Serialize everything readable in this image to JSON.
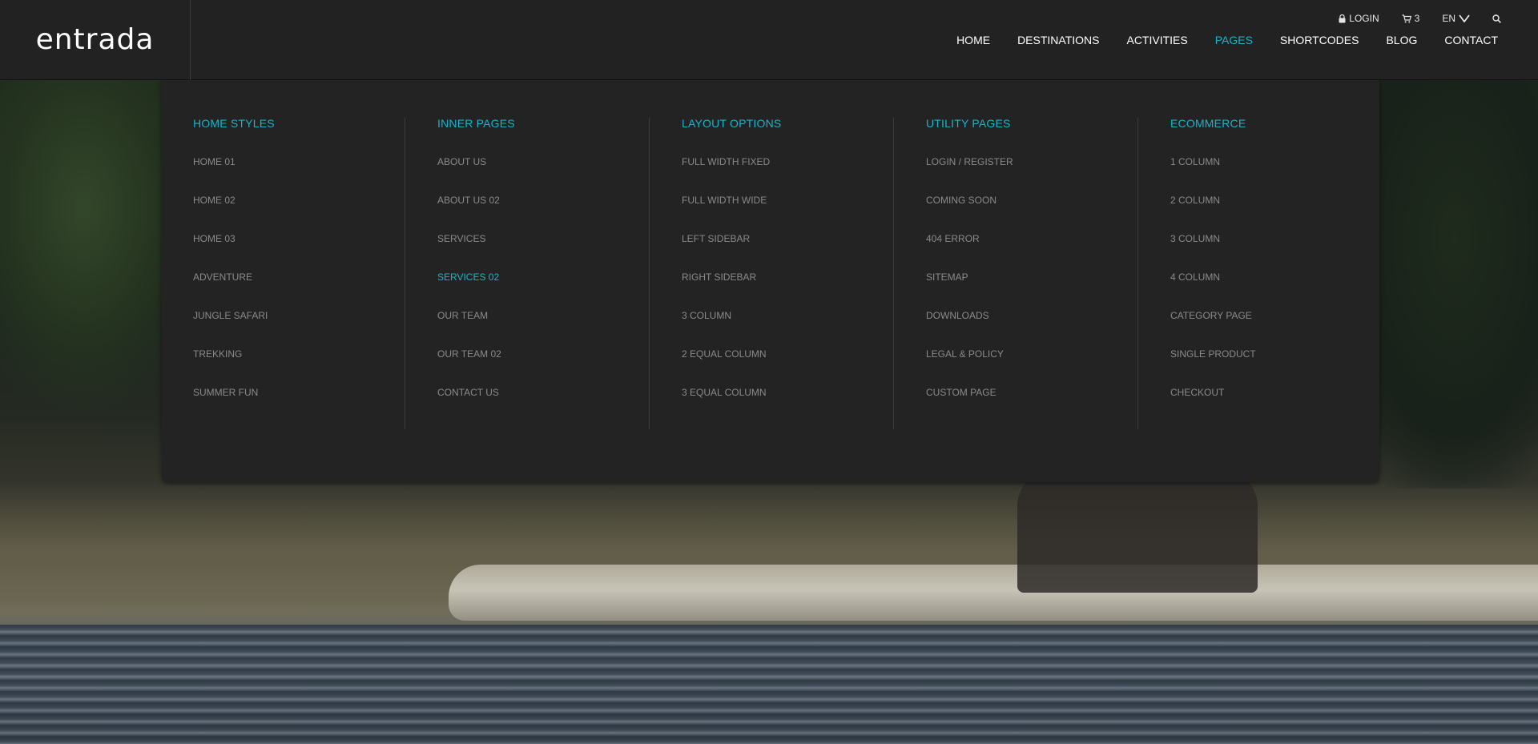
{
  "brand": {
    "logo_text": "entrada"
  },
  "utility": {
    "login_label": "LOGIN",
    "cart_count": "3",
    "language": "EN",
    "icons": {
      "login": "lock-icon",
      "cart": "cart-icon",
      "language": "chevron-down-icon",
      "search": "search-icon"
    }
  },
  "nav": {
    "items": [
      {
        "label": "HOME",
        "active": false
      },
      {
        "label": "DESTINATIONS",
        "active": false
      },
      {
        "label": "ACTIVITIES",
        "active": false
      },
      {
        "label": "PAGES",
        "active": true
      },
      {
        "label": "SHORTCODES",
        "active": false
      },
      {
        "label": "BLOG",
        "active": false
      },
      {
        "label": "CONTACT",
        "active": false
      }
    ]
  },
  "mega_menu": {
    "columns": [
      {
        "title": "HOME STYLES",
        "items": [
          "HOME 01",
          "HOME 02",
          "HOME 03",
          "ADVENTURE",
          "JUNGLE SAFARI",
          "TREKKING",
          "SUMMER FUN"
        ]
      },
      {
        "title": "INNER PAGES",
        "items": [
          "ABOUT US",
          "ABOUT US 02",
          "SERVICES",
          "SERVICES 02",
          "OUR TEAM",
          "OUR TEAM 02",
          "CONTACT US"
        ],
        "active_item": "SERVICES 02"
      },
      {
        "title": "LAYOUT OPTIONS",
        "items": [
          "FULL WIDTH FIXED",
          "FULL WIDTH WIDE",
          "LEFT SIDEBAR",
          "RIGHT SIDEBAR",
          "3 COLUMN",
          "2 EQUAL COLUMN",
          "3 EQUAL COLUMN"
        ]
      },
      {
        "title": "UTILITY PAGES",
        "items": [
          "LOGIN / REGISTER",
          "COMING SOON",
          "404 ERROR",
          "SITEMAP",
          "DOWNLOADS",
          "LEGAL & POLICY",
          "CUSTOM PAGE"
        ]
      },
      {
        "title": "ECOMMERCE",
        "items": [
          "1 COLUMN",
          "2 COLUMN",
          "3 COLUMN",
          "4 COLUMN",
          "CATEGORY PAGE",
          "SINGLE PRODUCT",
          "CHECKOUT"
        ]
      }
    ]
  },
  "colors": {
    "accent": "#1ab2cc",
    "header_bg": "#222222",
    "menu_bg": "#232323",
    "menu_item": "#8a8a8a"
  }
}
